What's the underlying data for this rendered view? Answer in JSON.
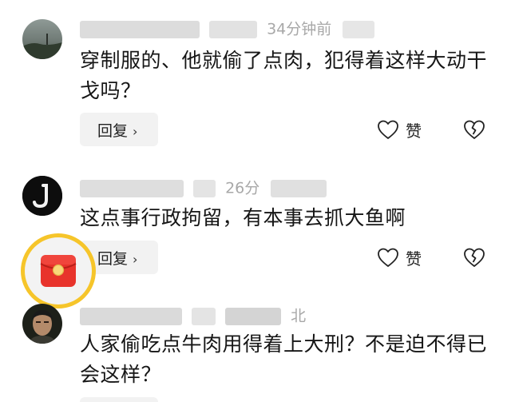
{
  "comments": [
    {
      "meta_visible": "34分钟前",
      "text": "穿制服的、他就偷了点肉，犯得着这样大动干戈吗？",
      "reply_label": "回复",
      "like_label": "赞"
    },
    {
      "meta_visible": "26分",
      "text": "这点事行政拘留，有本事去抓大鱼啊",
      "reply_label": "回复",
      "like_label": "赞"
    },
    {
      "meta_visible": "北",
      "text": "人家偷吃点牛肉用得着上大刑？不是迫不得已会这样？"
    }
  ],
  "icons": {
    "reply_chevron": "chevron-right-icon",
    "like": "heart-outline-icon",
    "dislike": "broken-heart-icon",
    "red_packet": "red-envelope-icon"
  },
  "colors": {
    "background": "#ffffff",
    "text": "#161616",
    "meta": "#a8a8a8",
    "button_bg": "#f2f2f2",
    "red_packet": "#e8332b",
    "red_packet_ring": "#f6c52a"
  }
}
